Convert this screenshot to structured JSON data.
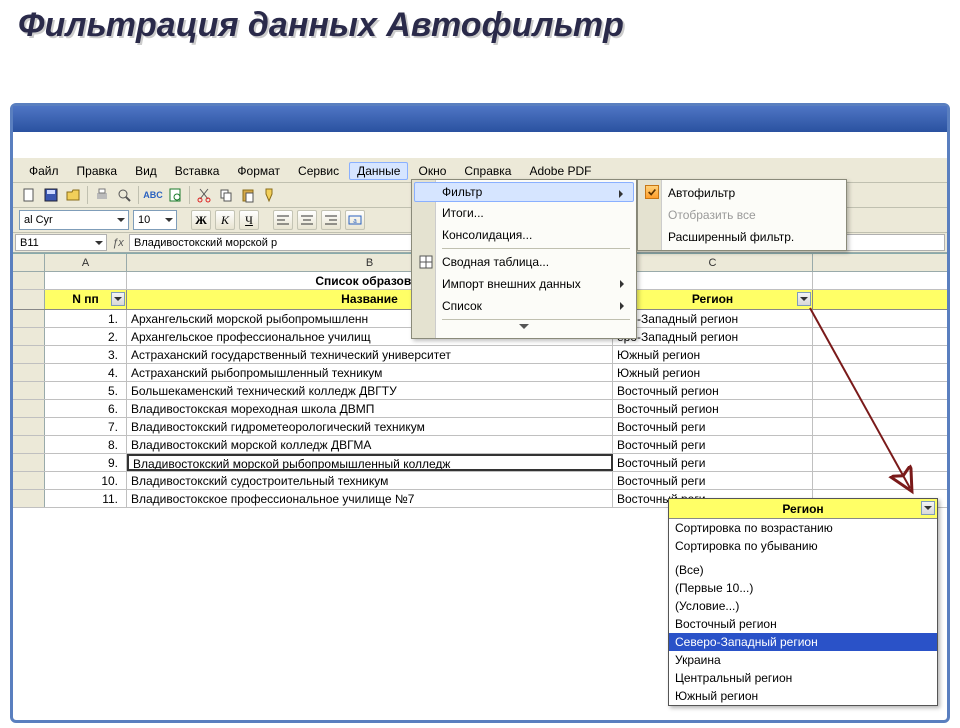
{
  "slide": {
    "title": "Фильтрация данных Автофильтр"
  },
  "menubar": {
    "file": "Файл",
    "edit": "Правка",
    "view": "Вид",
    "insert": "Вставка",
    "format": "Формат",
    "tools": "Сервис",
    "data": "Данные",
    "window": "Окно",
    "help": "Справка",
    "adobe": "Adobe PDF"
  },
  "data_menu": {
    "filter": "Фильтр",
    "subtotals": "Итоги...",
    "consolidate": "Консолидация...",
    "pivot": "Сводная таблица...",
    "import_ext": "Импорт внешних данных",
    "list": "Список"
  },
  "filter_submenu": {
    "autofilter": "Автофильтр",
    "show_all": "Отобразить все",
    "advanced": "Расширенный фильтр."
  },
  "format_bar": {
    "font_name": "al Cyr",
    "font_size": "10",
    "bold": "Ж",
    "italic": "К",
    "underline": "Ч"
  },
  "name_box": "B11",
  "formula": "Владивостокский морской р",
  "columns": {
    "A": "A",
    "B": "B",
    "C": "C"
  },
  "table_title": "Список образоват",
  "headers": {
    "n": "N пп",
    "name": "Название",
    "region": "Регион"
  },
  "rows": [
    {
      "n": "1.",
      "name": "Архангельский морской рыбопромышленн",
      "region": "еро-Западный регион"
    },
    {
      "n": "2.",
      "name": "Архангельское профессиональное училищ",
      "region": "еро-Западный регион"
    },
    {
      "n": "3.",
      "name": "Астраханский государственный технический университет",
      "region": "Южный регион"
    },
    {
      "n": "4.",
      "name": "Астраханский рыбопромышленный техникум",
      "region": "Южный регион"
    },
    {
      "n": "5.",
      "name": "Большекаменский технический колледж ДВГТУ",
      "region": "Восточный регион"
    },
    {
      "n": "6.",
      "name": "Владивостокская мореходная школа ДВМП",
      "region": "Восточный регион"
    },
    {
      "n": "7.",
      "name": "Владивостокский гидрометеорологический техникум",
      "region": "Восточный реги"
    },
    {
      "n": "8.",
      "name": "Владивостокский морской колледж ДВГМА",
      "region": "Восточный реги"
    },
    {
      "n": "9.",
      "name": "Владивостокский морской рыбопромышленный колледж",
      "region": "Восточный реги"
    },
    {
      "n": "10.",
      "name": "Владивостокский судостроительный техникум",
      "region": "Восточный реги"
    },
    {
      "n": "11.",
      "name": "Владивостокское профессиональное училище №7",
      "region": "Восточный реги"
    }
  ],
  "autofilter": {
    "header": "Регион",
    "sort_asc": "Сортировка по возрастанию",
    "sort_desc": "Сортировка по убыванию",
    "all": "(Все)",
    "top10": "(Первые 10...)",
    "custom": "(Условие...)",
    "opt1": "Восточный регион",
    "opt2": "Северо-Западный регион",
    "opt3": "Украина",
    "opt4": "Центральный регион",
    "opt5": "Южный регион"
  }
}
